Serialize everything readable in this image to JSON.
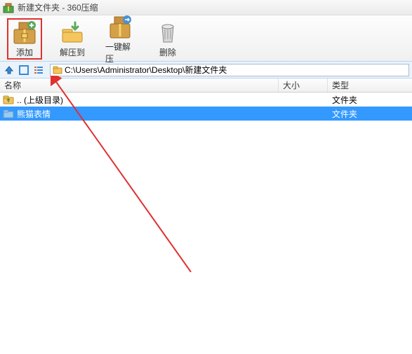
{
  "window": {
    "title": "新建文件夹 - 360压缩"
  },
  "toolbar": {
    "add": "添加",
    "extract_to": "解压到",
    "one_click": "一键解压",
    "delete": "删除"
  },
  "address": {
    "path": "C:\\Users\\Administrator\\Desktop\\新建文件夹"
  },
  "columns": {
    "name": "名称",
    "size": "大小",
    "type": "类型"
  },
  "rows": [
    {
      "name": ".. (上级目录)",
      "size": "",
      "type": "文件夹",
      "selected": false,
      "icon": "folder-up"
    },
    {
      "name": "熊猫表情",
      "size": "",
      "type": "文件夹",
      "selected": true,
      "icon": "folder"
    }
  ]
}
